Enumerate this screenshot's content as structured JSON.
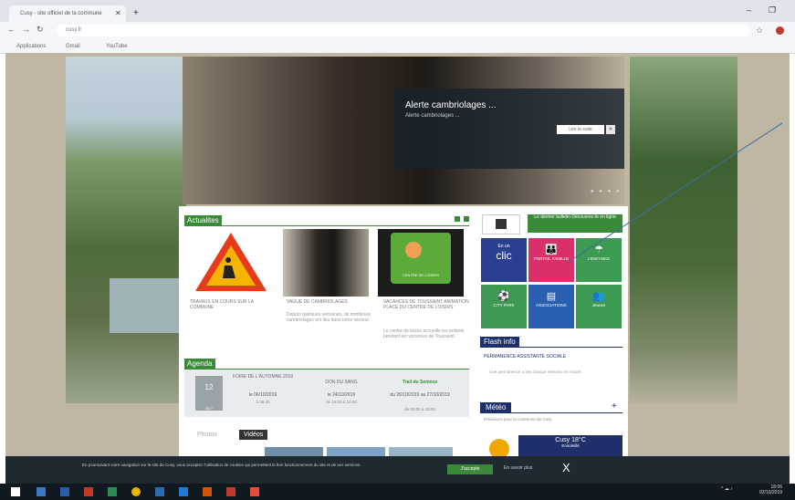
{
  "browser": {
    "tab_title": "Cusy - site officiel de la commune",
    "url": "cusy.fr",
    "bookmarks": [
      "Applications",
      "Gmail",
      "YouTube"
    ]
  },
  "hero": {
    "title": "Alerte cambriolages ...",
    "subtitle": "Alerte cambriolages ...",
    "button": "Lire la suite",
    "arrow": "»",
    "dots": "● ● ● ●"
  },
  "actualites": {
    "label": "Actualites",
    "cards": [
      {
        "title": "TRAVAUX EN COURS SUR LA COMMUNE",
        "text": ""
      },
      {
        "title": "VAGUE DE CAMBRIOLAGES",
        "text": "Depuis quelques semaines, de nombreux cambriolages ont lieu dans notre secteur."
      },
      {
        "title": "VACANCES DE TOUSSAINT ANIMATION PLACE DU CENTRE DE LOISIRS",
        "text": "Le centre de loisirs accueille les enfants pendant les vacances de Toussaint."
      }
    ],
    "card_sign": "CENTRE DE LOISIRS"
  },
  "agenda": {
    "label": "Agenda",
    "day": "12",
    "month": "OCT",
    "events": [
      {
        "title": "FOIRE DE L'AUTOMNE 2019",
        "date": "le 06/10/2019",
        "time": "à 08:30"
      },
      {
        "title": "DON DU SANG",
        "date": "le 24/10/2019",
        "time": "de 16:30 à 19:30"
      },
      {
        "title": "Trail du Semnoz",
        "date": "du 26/10/2019 au 27/10/2019",
        "time": "de 08:00 à 18:00"
      }
    ]
  },
  "media_tabs": {
    "photos": "Photos",
    "videos": "Vidéos"
  },
  "magazine": {
    "button": "Le dernier bulletin Découvrez-le en ligne"
  },
  "tiles": [
    {
      "label": "clic",
      "top": "En un",
      "color": "#2a3f8f"
    },
    {
      "label": "PORTAIL FAMILLE",
      "top": "",
      "color": "#d9306a"
    },
    {
      "label": "L'ENFANCE",
      "top": "",
      "color": "#3d9a52"
    },
    {
      "label": "CITY PARK",
      "top": "",
      "color": "#3d9a52"
    },
    {
      "label": "ASSOCIATIONS",
      "top": "",
      "color": "#2a5fb0"
    },
    {
      "label": "Jeunes",
      "top": "",
      "color": "#3d9a52"
    }
  ],
  "flash": {
    "label": "Flash info",
    "title": "PERMANENCE ASSISTANTE SOCIALE",
    "text": "Une permanence a lieu chaque semaine en mairie."
  },
  "meteo": {
    "label": "Météo",
    "plus": "+",
    "text": "Prévisions pour la commune de Cusy.",
    "city": "Cusy",
    "temp": "18°C",
    "sky": "Ensoleillé"
  },
  "cookie": {
    "text": "En poursuivant votre navigation sur le site de Cusy, vous acceptez l'utilisation de cookies qui permettent le bon fonctionnement du site et de ses services.",
    "accept": "J'accepte",
    "more": "En savoir plus",
    "close": "X"
  },
  "taskbar": {
    "clock": "18:06",
    "date": "02/10/2019"
  }
}
